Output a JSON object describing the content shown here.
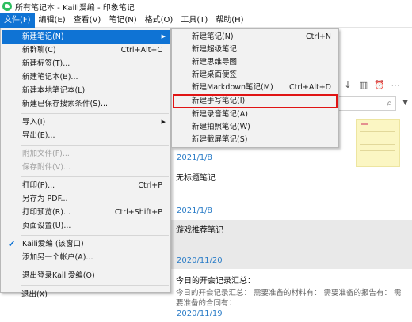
{
  "window": {
    "title": "所有笔记本 - Kaili爱编 - 印象笔记"
  },
  "menubar": {
    "items": [
      "文件(F)",
      "编辑(E)",
      "查看(V)",
      "笔记(N)",
      "格式(O)",
      "工具(T)",
      "帮助(H)"
    ],
    "active": "文件(F)"
  },
  "file_menu": {
    "items": [
      {
        "label": "新建笔记(N)",
        "shortcut": "",
        "submenu": true,
        "highlighted": true
      },
      {
        "label": "新群聊(C)",
        "shortcut": "Ctrl+Alt+C"
      },
      {
        "label": "新建标签(T)...",
        "shortcut": ""
      },
      {
        "label": "新建笔记本(B)...",
        "shortcut": ""
      },
      {
        "label": "新建本地笔记本(L)",
        "shortcut": ""
      },
      {
        "label": "新建已保存搜索条件(S)...",
        "shortcut": ""
      },
      {
        "label": "导入(I)",
        "shortcut": "",
        "submenu": true
      },
      {
        "label": "导出(E)...",
        "shortcut": ""
      },
      {
        "label": "附加文件(F)...",
        "shortcut": "",
        "disabled": true
      },
      {
        "label": "保存附件(V)...",
        "shortcut": "",
        "disabled": true
      },
      {
        "label": "打印(P)...",
        "shortcut": "Ctrl+P"
      },
      {
        "label": "另存为 PDF...",
        "shortcut": ""
      },
      {
        "label": "打印预览(R)...",
        "shortcut": "Ctrl+Shift+P"
      },
      {
        "label": "页面设置(U)...",
        "shortcut": ""
      },
      {
        "label": "Kaili爱编 (该窗口)",
        "shortcut": "",
        "checked": true
      },
      {
        "label": "添加另一个帐户(A)...",
        "shortcut": ""
      },
      {
        "label": "退出登录Kaili爱编(O)",
        "shortcut": ""
      },
      {
        "label": "退出(X)",
        "shortcut": ""
      }
    ]
  },
  "new_note_submenu": {
    "items": [
      {
        "label": "新建笔记(N)",
        "shortcut": "Ctrl+N"
      },
      {
        "label": "新建超级笔记",
        "shortcut": ""
      },
      {
        "label": "新建思维导图",
        "shortcut": ""
      },
      {
        "label": "新建桌面便签",
        "shortcut": ""
      },
      {
        "label": "新建Markdown笔记(M)",
        "shortcut": "Ctrl+Alt+D"
      },
      {
        "label": "新建手写笔记(I)",
        "shortcut": "",
        "boxed": true
      },
      {
        "label": "新建录音笔记(A)",
        "shortcut": ""
      },
      {
        "label": "新建拍照笔记(W)",
        "shortcut": ""
      },
      {
        "label": "新建截屏笔记(S)",
        "shortcut": ""
      }
    ]
  },
  "toolbar": {
    "icons": [
      "sort-icon",
      "view-icon",
      "reminder-icon",
      "more-icon"
    ],
    "glyphs": [
      "↓",
      "▥",
      "⏰",
      "⋯"
    ]
  },
  "search": {
    "icon": "search-icon",
    "dropdown": "▼"
  },
  "notes": [
    {
      "title": "",
      "snippet": "",
      "date": "2021/1/8"
    },
    {
      "title": "无标题笔记",
      "snippet": "",
      "date": "2021/1/8"
    },
    {
      "title": "游戏推荐笔记",
      "snippet": "",
      "date": "2020/11/20",
      "selected": true
    },
    {
      "title": "今日的开会记录汇总：",
      "snippet": "今日的开会记录汇总： 需要准备的材料有： 需要准备的报告有： 需要准备的合同有：",
      "date": "2020/11/19"
    }
  ],
  "colors": {
    "accent": "#0f73d4",
    "date_blue": "#2a7cc7",
    "highlight_box": "#e01414",
    "note_thumb": "#fbf6c3"
  }
}
